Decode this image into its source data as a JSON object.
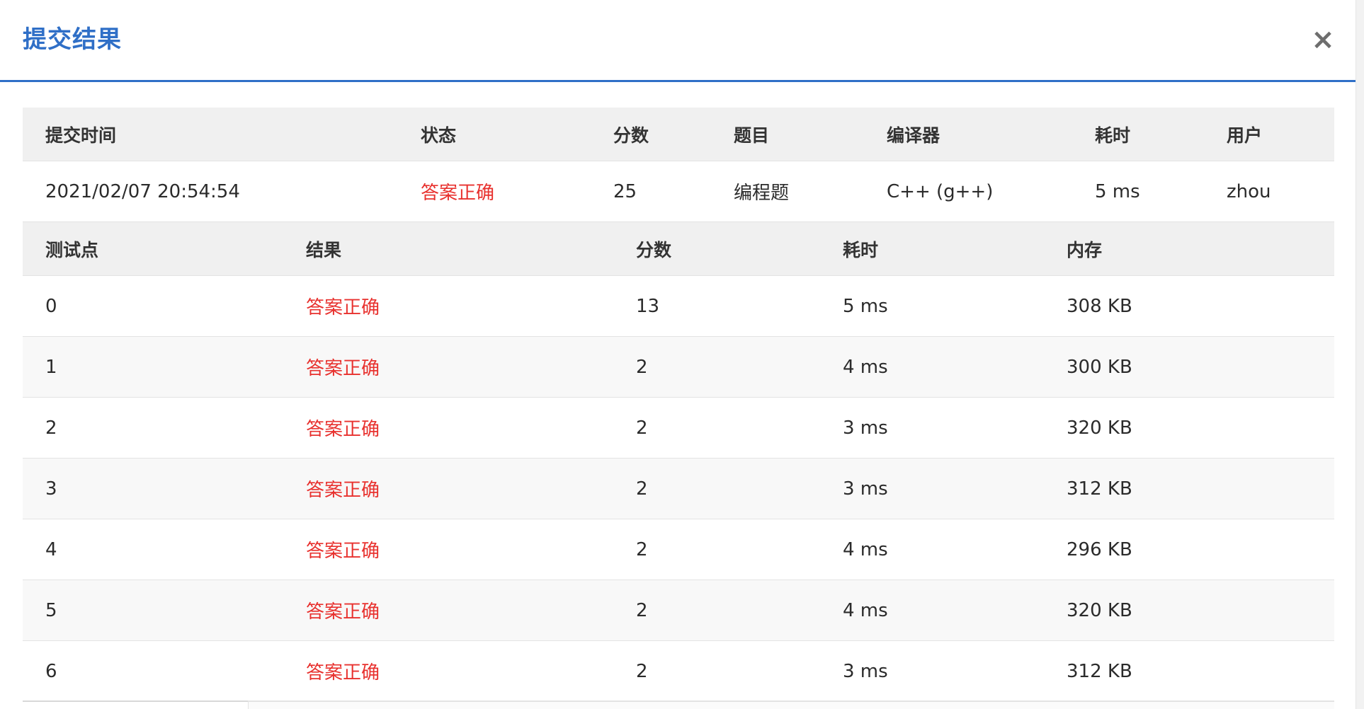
{
  "dialog": {
    "title": "提交结果",
    "close_label": "×"
  },
  "submission": {
    "headers": {
      "time": "提交时间",
      "status": "状态",
      "score": "分数",
      "problem": "题目",
      "compiler": "编译器",
      "elapsed": "耗时",
      "user": "用户"
    },
    "row": {
      "time": "2021/02/07 20:54:54",
      "status": "答案正确",
      "score": "25",
      "problem": "编程题",
      "compiler": "C++ (g++)",
      "elapsed": "5 ms",
      "user": "zhou"
    }
  },
  "tests": {
    "headers": {
      "point": "测试点",
      "result": "结果",
      "score": "分数",
      "elapsed": "耗时",
      "memory": "内存"
    },
    "rows": [
      {
        "point": "0",
        "result": "答案正确",
        "score": "13",
        "elapsed": "5 ms",
        "memory": "308 KB"
      },
      {
        "point": "1",
        "result": "答案正确",
        "score": "2",
        "elapsed": "4 ms",
        "memory": "300 KB"
      },
      {
        "point": "2",
        "result": "答案正确",
        "score": "2",
        "elapsed": "3 ms",
        "memory": "320 KB"
      },
      {
        "point": "3",
        "result": "答案正确",
        "score": "2",
        "elapsed": "3 ms",
        "memory": "312 KB"
      },
      {
        "point": "4",
        "result": "答案正确",
        "score": "2",
        "elapsed": "4 ms",
        "memory": "296 KB"
      },
      {
        "point": "5",
        "result": "答案正确",
        "score": "2",
        "elapsed": "4 ms",
        "memory": "320 KB"
      },
      {
        "point": "6",
        "result": "答案正确",
        "score": "2",
        "elapsed": "3 ms",
        "memory": "312 KB"
      }
    ]
  },
  "colors": {
    "accent": "#2f6fc7",
    "status_ok": "#e8312e",
    "header_bg": "#f0f0f0"
  }
}
